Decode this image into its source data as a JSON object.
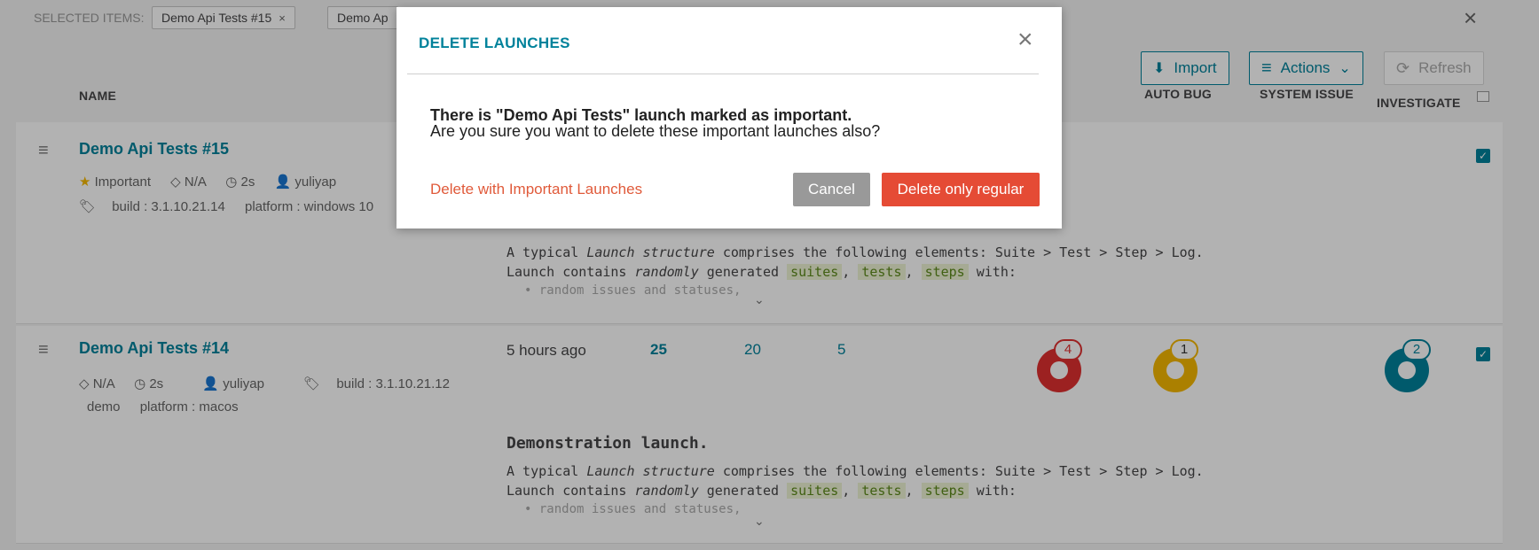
{
  "selected_bar": {
    "label": "SELECTED ITEMS:",
    "chips": [
      "Demo Api Tests #15",
      "Demo Ap"
    ],
    "chip_remove": "×",
    "close": "×"
  },
  "toolbar": {
    "import_label": "Import",
    "actions_label": "Actions",
    "refresh_label": "Refresh"
  },
  "columns": {
    "name": "NAME",
    "auto_bug": "AUTO BUG",
    "system_issue": "SYSTEM ISSUE",
    "to_investigate": "INVESTIGATE"
  },
  "launches": [
    {
      "name": "Demo Api Tests #15",
      "important_label": "Important",
      "analyzer": "N/A",
      "duration": "2s",
      "owner": "yuliyap",
      "attributes": [
        "build : 3.1.10.21.14",
        "platform : windows 10"
      ],
      "description": {
        "line1_a": "A typical ",
        "line1_i": "Launch structure",
        "line1_b": " comprises the following elements: Suite > Test > Step > Log.",
        "line2_a": "Launch contains ",
        "line2_i": "randomly",
        "line2_b": " generated ",
        "hl1": "suites",
        "hl2": "tests",
        "hl3": "steps",
        "line2_c": " with:",
        "bullet": "random issues and statuses,"
      }
    },
    {
      "name": "Demo Api Tests #14",
      "analyzer": "N/A",
      "duration": "2s",
      "owner": "yuliyap",
      "attributes": [
        "build : 3.1.10.21.12",
        "demo",
        "platform : macos"
      ],
      "time": "5 hours ago",
      "total": "25",
      "passed": "20",
      "failed": "5",
      "product_bug": "4",
      "auto_bug": "1",
      "to_investigate": "2",
      "description": {
        "title": "Demonstration launch.",
        "line1_a": "A typical ",
        "line1_i": "Launch structure",
        "line1_b": " comprises the following elements: Suite > Test > Step > Log.",
        "line2_a": "Launch contains ",
        "line2_i": "randomly",
        "line2_b": " generated ",
        "hl1": "suites",
        "hl2": "tests",
        "hl3": "steps",
        "line2_c": " with:",
        "bullet": "random issues and statuses,"
      }
    }
  ],
  "modal": {
    "title": "DELETE LAUNCHES",
    "close": "×",
    "message_line1": "There is \"Demo Api Tests\" launch marked as important.",
    "message_line2": "Are you sure you want to delete these important launches also?",
    "delete_important_label": "Delete with Important Launches",
    "cancel_label": "Cancel",
    "delete_regular_label": "Delete only regular"
  },
  "colors": {
    "accent": "#00829b",
    "danger": "#e54b35",
    "product_bug": "#e03030",
    "auto_bug": "#f5b800",
    "to_investigate": "#00829b"
  },
  "icons": {
    "hamburger": "≡",
    "star": "★",
    "diamond": "◇",
    "clock": "◷",
    "user": "👤",
    "tag": "🏷",
    "check": "✓",
    "chevron": "⌄"
  }
}
